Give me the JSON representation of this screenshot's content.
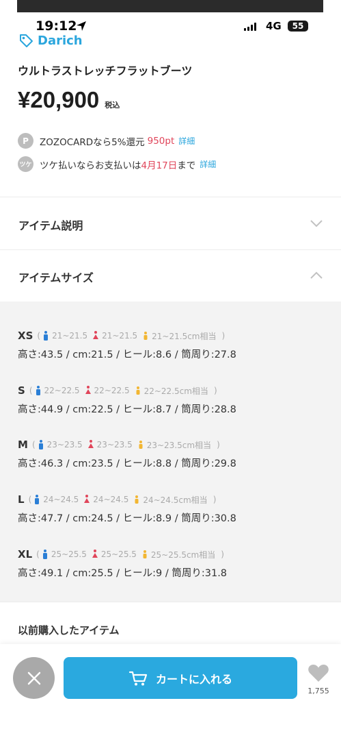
{
  "status_bar": {
    "time": "19:12",
    "network": "4G",
    "battery": "55"
  },
  "brand": {
    "name": "Darich"
  },
  "product": {
    "name": "ウルトラストレッチフラットブーツ",
    "price": "¥20,900",
    "tax_label": "税込"
  },
  "points": {
    "icon": "P",
    "text": "ZOZOCARDなら5%還元",
    "amount": "950pt",
    "detail": "詳細"
  },
  "tsuke": {
    "icon": "ツケ",
    "text_before": "ツケ払いならお支払いは",
    "date": "4月17日",
    "text_after": "まで",
    "detail": "詳細"
  },
  "accordion": {
    "description": {
      "title": "アイテム説明",
      "state": "collapsed"
    },
    "size": {
      "title": "アイテムサイズ",
      "state": "expanded"
    }
  },
  "sizes": [
    {
      "label": "XS",
      "men": "21~21.5",
      "women": "21~21.5",
      "kids": "21~21.5cm相当",
      "detail": "高さ:43.5 / cm:21.5 / ヒール:8.6 / 筒周り:27.8"
    },
    {
      "label": "S",
      "men": "22~22.5",
      "women": "22~22.5",
      "kids": "22~22.5cm相当",
      "detail": "高さ:44.9 / cm:22.5 / ヒール:8.7 / 筒周り:28.8"
    },
    {
      "label": "M",
      "men": "23~23.5",
      "women": "23~23.5",
      "kids": "23~23.5cm相当",
      "detail": "高さ:46.3 / cm:23.5 / ヒール:8.8 / 筒周り:29.8"
    },
    {
      "label": "L",
      "men": "24~24.5",
      "women": "24~24.5",
      "kids": "24~24.5cm相当",
      "detail": "高さ:47.7 / cm:24.5 / ヒール:8.9 / 筒周り:30.8"
    },
    {
      "label": "XL",
      "men": "25~25.5",
      "women": "25~25.5",
      "kids": "25~25.5cm相当",
      "detail": "高さ:49.1 / cm:25.5 / ヒール:9 / 筒周り:31.8"
    }
  ],
  "previous": {
    "title": "以前購入したアイテム"
  },
  "bottom_bar": {
    "cart_label": "カートに入れる",
    "favorite_count": "1,755"
  },
  "colors": {
    "accent": "#2aa9df",
    "price_red": "#e0455a",
    "men": "#2b7fd6",
    "women": "#e0455a",
    "kids": "#f2b632"
  }
}
